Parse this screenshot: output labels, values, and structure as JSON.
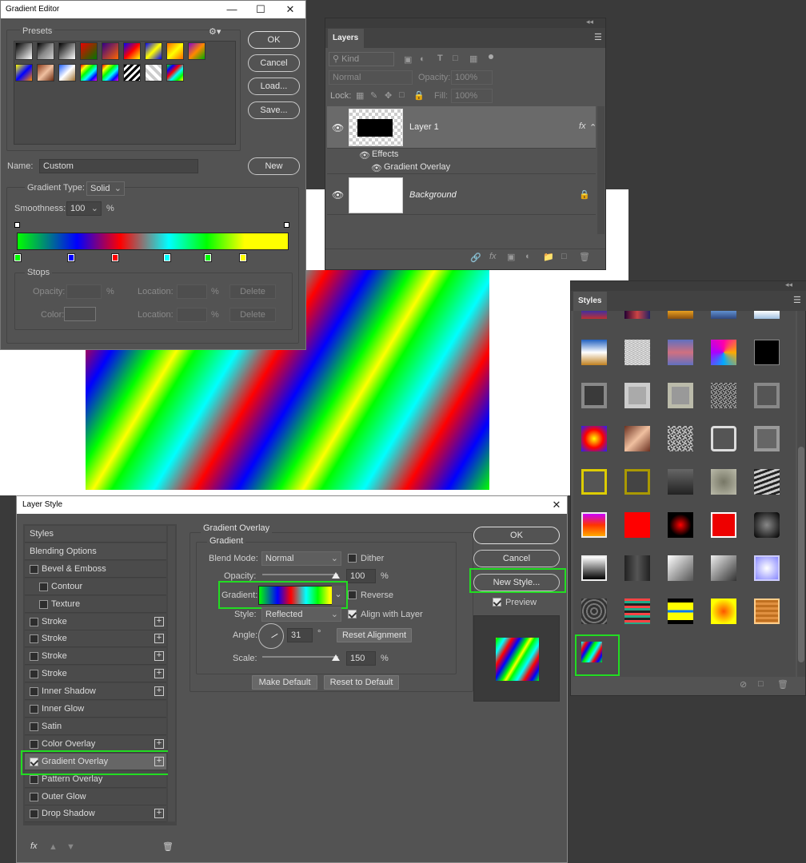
{
  "gradient_editor": {
    "title": "Gradient Editor",
    "presets_label": "Presets",
    "ok": "OK",
    "cancel": "Cancel",
    "load": "Load...",
    "save": "Save...",
    "name_label": "Name:",
    "name_value": "Custom",
    "new": "New",
    "gradient_type_label": "Gradient Type:",
    "gradient_type_value": "Solid",
    "smoothness_label": "Smoothness:",
    "smoothness_value": "100",
    "smoothness_unit": "%",
    "stops_label": "Stops",
    "opacity_label": "Opacity:",
    "location_label": "Location:",
    "color_label": "Color:",
    "percent": "%",
    "delete": "Delete",
    "stop_colors": [
      "#00ff00",
      "#0000ff",
      "#ff0000",
      "#00ffff",
      "#00ff00",
      "#ffff00"
    ]
  },
  "layers": {
    "tab": "Layers",
    "kind": "Kind",
    "blend": "Normal",
    "opacity_label": "Opacity:",
    "opacity_value": "100%",
    "lock_label": "Lock:",
    "fill_label": "Fill:",
    "fill_value": "100%",
    "layer1": "Layer 1",
    "fx": "fx",
    "effects": "Effects",
    "gradient_overlay": "Gradient Overlay",
    "background": "Background"
  },
  "styles": {
    "tab": "Styles"
  },
  "layer_style": {
    "title": "Layer Style",
    "sidebar": [
      {
        "label": "Styles",
        "check": false,
        "plus": false,
        "indent": false,
        "hdr": true
      },
      {
        "label": "Blending Options",
        "check": false,
        "plus": false,
        "indent": false,
        "hdr": true
      },
      {
        "label": "Bevel & Emboss",
        "check": true,
        "plus": false,
        "indent": false
      },
      {
        "label": "Contour",
        "check": true,
        "plus": false,
        "indent": true
      },
      {
        "label": "Texture",
        "check": true,
        "plus": false,
        "indent": true
      },
      {
        "label": "Stroke",
        "check": true,
        "plus": true,
        "indent": false
      },
      {
        "label": "Stroke",
        "check": true,
        "plus": true,
        "indent": false
      },
      {
        "label": "Stroke",
        "check": true,
        "plus": true,
        "indent": false
      },
      {
        "label": "Stroke",
        "check": true,
        "plus": true,
        "indent": false
      },
      {
        "label": "Inner Shadow",
        "check": true,
        "plus": true,
        "indent": false
      },
      {
        "label": "Inner Glow",
        "check": true,
        "plus": false,
        "indent": false
      },
      {
        "label": "Satin",
        "check": true,
        "plus": false,
        "indent": false
      },
      {
        "label": "Color Overlay",
        "check": true,
        "plus": true,
        "indent": false
      },
      {
        "label": "Gradient Overlay",
        "check": true,
        "plus": true,
        "indent": false,
        "checked": true
      },
      {
        "label": "Pattern Overlay",
        "check": true,
        "plus": false,
        "indent": false
      },
      {
        "label": "Outer Glow",
        "check": true,
        "plus": false,
        "indent": false
      },
      {
        "label": "Drop Shadow",
        "check": true,
        "plus": true,
        "indent": false
      }
    ],
    "section_title": "Gradient Overlay",
    "sub_title": "Gradient",
    "blend_mode_label": "Blend Mode:",
    "blend_mode_value": "Normal",
    "dither": "Dither",
    "opacity_label": "Opacity:",
    "opacity_value": "100",
    "gradient_label": "Gradient:",
    "reverse": "Reverse",
    "style_label": "Style:",
    "style_value": "Reflected",
    "align": "Align with Layer",
    "angle_label": "Angle:",
    "angle_value": "31",
    "degree": "°",
    "reset_alignment": "Reset Alignment",
    "scale_label": "Scale:",
    "scale_value": "150",
    "percent": "%",
    "make_default": "Make Default",
    "reset_default": "Reset to Default",
    "ok": "OK",
    "cancel": "Cancel",
    "new_style": "New Style...",
    "preview": "Preview",
    "fx": "fx"
  }
}
